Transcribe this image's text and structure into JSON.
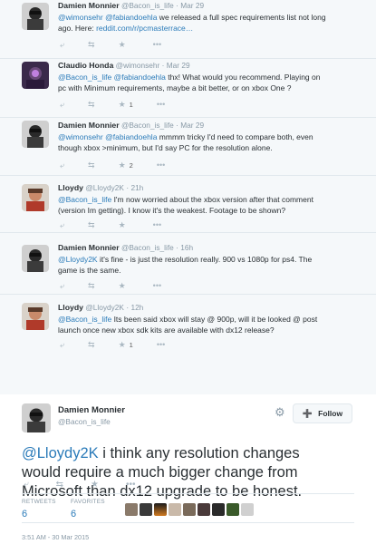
{
  "replies": [
    {
      "name": "Damien Monnier",
      "handle": "@Bacon_is_life",
      "time": "Mar 29",
      "lines": [
        [
          {
            "t": "@wimonsehr",
            "link": true
          },
          {
            "t": " "
          },
          {
            "t": "@fabiandoehla",
            "link": true
          },
          {
            "t": " we released a full spec requirements list not long"
          }
        ],
        [
          {
            "t": "ago. Here: "
          },
          {
            "t": "reddit.com/r/pcmasterrace…",
            "link": true
          }
        ]
      ],
      "count": ""
    },
    {
      "name": "Claudio Honda",
      "handle": "@wimonsehr",
      "time": "Mar 29",
      "lines": [
        [
          {
            "t": "@Bacon_is_life",
            "link": true
          },
          {
            "t": " "
          },
          {
            "t": "@fabiandoehla",
            "link": true
          },
          {
            "t": " thx! What would you recommend. Playing on"
          }
        ],
        [
          {
            "t": "pc with Minimum requirements, maybe a bit better, or on xbox One ?"
          }
        ]
      ],
      "count": "1"
    },
    {
      "name": "Damien Monnier",
      "handle": "@Bacon_is_life",
      "time": "Mar 29",
      "lines": [
        [
          {
            "t": "@wimonsehr",
            "link": true
          },
          {
            "t": " "
          },
          {
            "t": "@fabiandoehla",
            "link": true
          },
          {
            "t": " mmmm tricky I'd need to compare both, even"
          }
        ],
        [
          {
            "t": "though xbox >minimum, but I'd say PC for the resolution alone."
          }
        ]
      ],
      "count": "2"
    },
    {
      "name": "Lloydy",
      "handle": "@Lloydy2K",
      "time": "21h",
      "lines": [
        [
          {
            "t": "@Bacon_is_life",
            "link": true
          },
          {
            "t": " I'm now worried about the xbox version after that comment"
          }
        ],
        [
          {
            "t": "(version Im getting). I know it's the weakest. Footage to be shown?"
          }
        ]
      ],
      "count": ""
    },
    {
      "name": "Damien Monnier",
      "handle": "@Bacon_is_life",
      "time": "16h",
      "lines": [
        [
          {
            "t": "@Lloydy2K",
            "link": true
          },
          {
            "t": " it's fine - is just the resolution really. 900 vs 1080p for ps4. The"
          }
        ],
        [
          {
            "t": "game is the same."
          }
        ]
      ],
      "count": ""
    },
    {
      "name": "Lloydy",
      "handle": "@Lloydy2K",
      "time": "12h",
      "lines": [
        [
          {
            "t": "@Bacon_is_life",
            "link": true
          },
          {
            "t": " Its been said xbox will stay @ 900p, will it be looked @ post"
          }
        ],
        [
          {
            "t": "launch once new xbox sdk kits are available with dx12 release?"
          }
        ]
      ],
      "count": "1"
    }
  ],
  "icons": {
    "reply": "reply-icon",
    "retweet": "retweet-icon",
    "favorite": "star-icon",
    "more": "more-icon"
  },
  "main": {
    "name": "Damien Monnier",
    "handle": "@Bacon_is_life",
    "follow_label": "Follow",
    "text_mention": "@Lloydy2K",
    "text_line1": " i think any resolution changes",
    "text_line2": "would require a much bigger change from",
    "text_line3": "Microsoft than dx12 upgrade to be honest.",
    "retweets_label": "RETWEETS",
    "retweets_value": "6",
    "favorites_label": "FAVORITES",
    "favorites_value": "6",
    "date": "3:51 AM - 30 Mar 2015"
  },
  "colors": {
    "link": "#2b7bb9",
    "thread_bg": "#f5f8fa",
    "muted": "#8899a6"
  }
}
